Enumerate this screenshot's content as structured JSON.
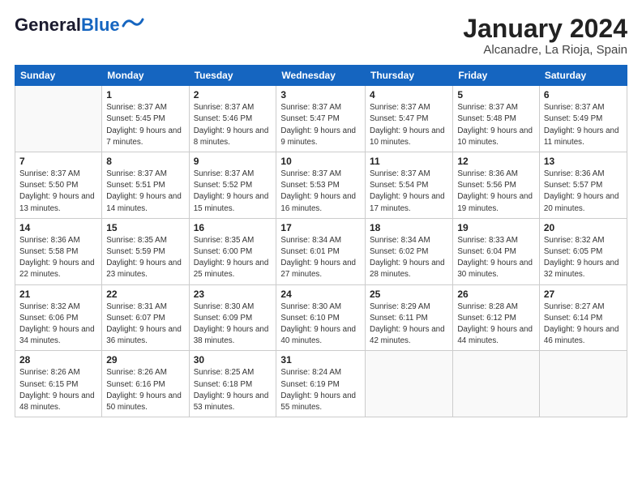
{
  "header": {
    "logo_general": "General",
    "logo_blue": "Blue",
    "month_title": "January 2024",
    "location": "Alcanadre, La Rioja, Spain"
  },
  "days_of_week": [
    "Sunday",
    "Monday",
    "Tuesday",
    "Wednesday",
    "Thursday",
    "Friday",
    "Saturday"
  ],
  "weeks": [
    [
      {
        "num": "",
        "sunrise": "",
        "sunset": "",
        "daylight": ""
      },
      {
        "num": "1",
        "sunrise": "Sunrise: 8:37 AM",
        "sunset": "Sunset: 5:45 PM",
        "daylight": "Daylight: 9 hours and 7 minutes."
      },
      {
        "num": "2",
        "sunrise": "Sunrise: 8:37 AM",
        "sunset": "Sunset: 5:46 PM",
        "daylight": "Daylight: 9 hours and 8 minutes."
      },
      {
        "num": "3",
        "sunrise": "Sunrise: 8:37 AM",
        "sunset": "Sunset: 5:47 PM",
        "daylight": "Daylight: 9 hours and 9 minutes."
      },
      {
        "num": "4",
        "sunrise": "Sunrise: 8:37 AM",
        "sunset": "Sunset: 5:47 PM",
        "daylight": "Daylight: 9 hours and 10 minutes."
      },
      {
        "num": "5",
        "sunrise": "Sunrise: 8:37 AM",
        "sunset": "Sunset: 5:48 PM",
        "daylight": "Daylight: 9 hours and 10 minutes."
      },
      {
        "num": "6",
        "sunrise": "Sunrise: 8:37 AM",
        "sunset": "Sunset: 5:49 PM",
        "daylight": "Daylight: 9 hours and 11 minutes."
      }
    ],
    [
      {
        "num": "7",
        "sunrise": "Sunrise: 8:37 AM",
        "sunset": "Sunset: 5:50 PM",
        "daylight": "Daylight: 9 hours and 13 minutes."
      },
      {
        "num": "8",
        "sunrise": "Sunrise: 8:37 AM",
        "sunset": "Sunset: 5:51 PM",
        "daylight": "Daylight: 9 hours and 14 minutes."
      },
      {
        "num": "9",
        "sunrise": "Sunrise: 8:37 AM",
        "sunset": "Sunset: 5:52 PM",
        "daylight": "Daylight: 9 hours and 15 minutes."
      },
      {
        "num": "10",
        "sunrise": "Sunrise: 8:37 AM",
        "sunset": "Sunset: 5:53 PM",
        "daylight": "Daylight: 9 hours and 16 minutes."
      },
      {
        "num": "11",
        "sunrise": "Sunrise: 8:37 AM",
        "sunset": "Sunset: 5:54 PM",
        "daylight": "Daylight: 9 hours and 17 minutes."
      },
      {
        "num": "12",
        "sunrise": "Sunrise: 8:36 AM",
        "sunset": "Sunset: 5:56 PM",
        "daylight": "Daylight: 9 hours and 19 minutes."
      },
      {
        "num": "13",
        "sunrise": "Sunrise: 8:36 AM",
        "sunset": "Sunset: 5:57 PM",
        "daylight": "Daylight: 9 hours and 20 minutes."
      }
    ],
    [
      {
        "num": "14",
        "sunrise": "Sunrise: 8:36 AM",
        "sunset": "Sunset: 5:58 PM",
        "daylight": "Daylight: 9 hours and 22 minutes."
      },
      {
        "num": "15",
        "sunrise": "Sunrise: 8:35 AM",
        "sunset": "Sunset: 5:59 PM",
        "daylight": "Daylight: 9 hours and 23 minutes."
      },
      {
        "num": "16",
        "sunrise": "Sunrise: 8:35 AM",
        "sunset": "Sunset: 6:00 PM",
        "daylight": "Daylight: 9 hours and 25 minutes."
      },
      {
        "num": "17",
        "sunrise": "Sunrise: 8:34 AM",
        "sunset": "Sunset: 6:01 PM",
        "daylight": "Daylight: 9 hours and 27 minutes."
      },
      {
        "num": "18",
        "sunrise": "Sunrise: 8:34 AM",
        "sunset": "Sunset: 6:02 PM",
        "daylight": "Daylight: 9 hours and 28 minutes."
      },
      {
        "num": "19",
        "sunrise": "Sunrise: 8:33 AM",
        "sunset": "Sunset: 6:04 PM",
        "daylight": "Daylight: 9 hours and 30 minutes."
      },
      {
        "num": "20",
        "sunrise": "Sunrise: 8:32 AM",
        "sunset": "Sunset: 6:05 PM",
        "daylight": "Daylight: 9 hours and 32 minutes."
      }
    ],
    [
      {
        "num": "21",
        "sunrise": "Sunrise: 8:32 AM",
        "sunset": "Sunset: 6:06 PM",
        "daylight": "Daylight: 9 hours and 34 minutes."
      },
      {
        "num": "22",
        "sunrise": "Sunrise: 8:31 AM",
        "sunset": "Sunset: 6:07 PM",
        "daylight": "Daylight: 9 hours and 36 minutes."
      },
      {
        "num": "23",
        "sunrise": "Sunrise: 8:30 AM",
        "sunset": "Sunset: 6:09 PM",
        "daylight": "Daylight: 9 hours and 38 minutes."
      },
      {
        "num": "24",
        "sunrise": "Sunrise: 8:30 AM",
        "sunset": "Sunset: 6:10 PM",
        "daylight": "Daylight: 9 hours and 40 minutes."
      },
      {
        "num": "25",
        "sunrise": "Sunrise: 8:29 AM",
        "sunset": "Sunset: 6:11 PM",
        "daylight": "Daylight: 9 hours and 42 minutes."
      },
      {
        "num": "26",
        "sunrise": "Sunrise: 8:28 AM",
        "sunset": "Sunset: 6:12 PM",
        "daylight": "Daylight: 9 hours and 44 minutes."
      },
      {
        "num": "27",
        "sunrise": "Sunrise: 8:27 AM",
        "sunset": "Sunset: 6:14 PM",
        "daylight": "Daylight: 9 hours and 46 minutes."
      }
    ],
    [
      {
        "num": "28",
        "sunrise": "Sunrise: 8:26 AM",
        "sunset": "Sunset: 6:15 PM",
        "daylight": "Daylight: 9 hours and 48 minutes."
      },
      {
        "num": "29",
        "sunrise": "Sunrise: 8:26 AM",
        "sunset": "Sunset: 6:16 PM",
        "daylight": "Daylight: 9 hours and 50 minutes."
      },
      {
        "num": "30",
        "sunrise": "Sunrise: 8:25 AM",
        "sunset": "Sunset: 6:18 PM",
        "daylight": "Daylight: 9 hours and 53 minutes."
      },
      {
        "num": "31",
        "sunrise": "Sunrise: 8:24 AM",
        "sunset": "Sunset: 6:19 PM",
        "daylight": "Daylight: 9 hours and 55 minutes."
      },
      {
        "num": "",
        "sunrise": "",
        "sunset": "",
        "daylight": ""
      },
      {
        "num": "",
        "sunrise": "",
        "sunset": "",
        "daylight": ""
      },
      {
        "num": "",
        "sunrise": "",
        "sunset": "",
        "daylight": ""
      }
    ]
  ]
}
